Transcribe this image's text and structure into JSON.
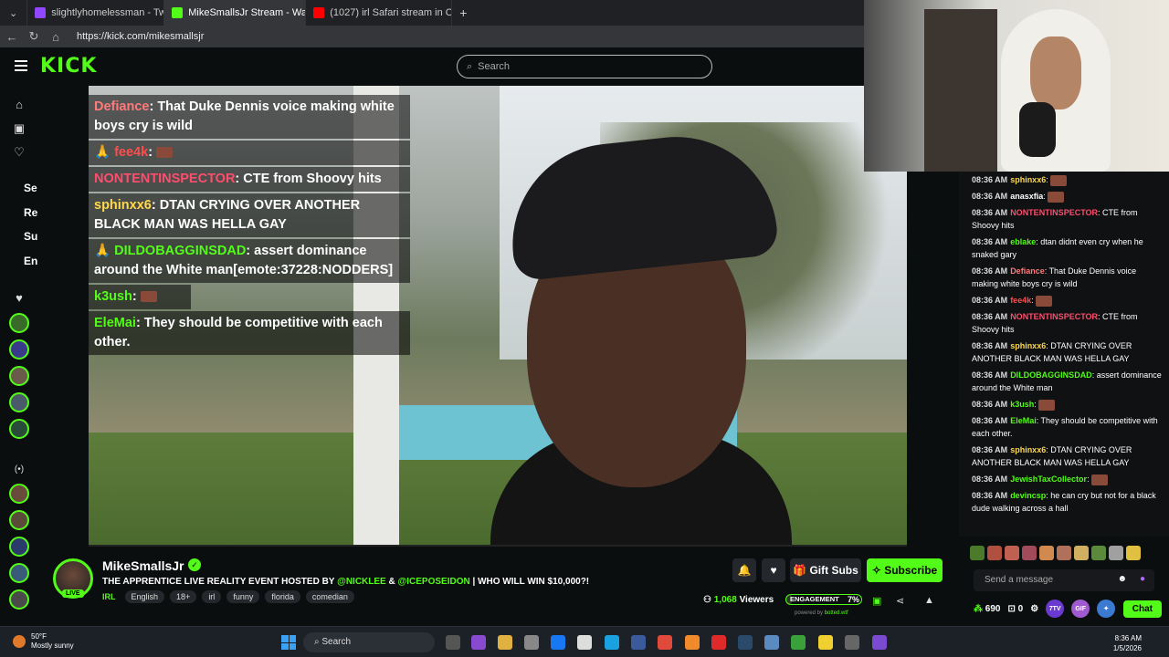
{
  "browser": {
    "tabs": [
      {
        "label": "slightlyhomelessman - Twitch",
        "color": "#9146ff",
        "active": false
      },
      {
        "label": "MikeSmallsJr Stream - Watch",
        "color": "#53fc18",
        "active": true
      },
      {
        "label": "(1027) irl Safari stream in Okl",
        "color": "#ff0000",
        "active": false
      }
    ],
    "new_tab": "+",
    "url": "https://kick.com/mikesmallsjr"
  },
  "header": {
    "logo": "KICK",
    "search_placeholder": "Search"
  },
  "leftnav": {
    "labels": [
      "Se",
      "Re",
      "Su",
      "En"
    ]
  },
  "overlay_chat": [
    {
      "user": "Defiance",
      "user_color": "#ff7a7a",
      "text": "That Duke Dennis voice making white boys cry is wild"
    },
    {
      "user": "fee4k",
      "user_color": "#ff4d4d",
      "text": ""
    },
    {
      "user": "NONTENTINSPECTOR",
      "user_color": "#ff4d6d",
      "text": "CTE from Shoovy hits"
    },
    {
      "user": "sphinxx6",
      "user_color": "#ffd84d",
      "text": "DTAN CRYING OVER ANOTHER BLACK MAN WAS HELLA GAY"
    },
    {
      "user": "DILDOBAGGINSDAD",
      "user_color": "#53fc18",
      "text": "assert dominance around the White man[emote:37228:NODDERS]"
    },
    {
      "user": "k3ush",
      "user_color": "#53fc18",
      "text": ""
    },
    {
      "user": "EleMai",
      "user_color": "#53fc18",
      "text": "They should be competitive with each other."
    }
  ],
  "chat": {
    "messages": [
      {
        "time": "08:36 AM",
        "user": "sphinxx6",
        "user_color": "#ffd84d",
        "text": ""
      },
      {
        "time": "08:36 AM",
        "user": "anasxfia",
        "user_color": "#ffffff",
        "text": ""
      },
      {
        "time": "08:36 AM",
        "user": "NONTENTINSPECTOR",
        "user_color": "#ff4d6d",
        "text": "CTE from Shoovy hits"
      },
      {
        "time": "08:36 AM",
        "user": "eblake",
        "user_color": "#53fc18",
        "text": "dtan didnt even cry when he snaked gary"
      },
      {
        "time": "08:36 AM",
        "user": "Defiance",
        "user_color": "#ff7a7a",
        "text": "That Duke Dennis voice making white boys cry is wild"
      },
      {
        "time": "08:36 AM",
        "user": "fee4k",
        "user_color": "#ff4d4d",
        "text": ""
      },
      {
        "time": "08:36 AM",
        "user": "NONTENTINSPECTOR",
        "user_color": "#ff4d6d",
        "text": "CTE from Shoovy hits"
      },
      {
        "time": "08:36 AM",
        "user": "sphinxx6",
        "user_color": "#ffd84d",
        "text": "DTAN CRYING OVER ANOTHER BLACK MAN WAS HELLA GAY"
      },
      {
        "time": "08:36 AM",
        "user": "DILDOBAGGINSDAD",
        "user_color": "#53fc18",
        "text": "assert dominance around the White man"
      },
      {
        "time": "08:36 AM",
        "user": "k3ush",
        "user_color": "#53fc18",
        "text": ""
      },
      {
        "time": "08:36 AM",
        "user": "EleMai",
        "user_color": "#53fc18",
        "text": "They should be competitive with each other."
      },
      {
        "time": "08:36 AM",
        "user": "sphinxx6",
        "user_color": "#ffd84d",
        "text": "DTAN CRYING OVER ANOTHER BLACK MAN WAS HELLA GAY"
      },
      {
        "time": "08:36 AM",
        "user": "JewishTaxCollector",
        "user_color": "#53fc18",
        "text": ""
      },
      {
        "time": "08:36 AM",
        "user": "devincsp",
        "user_color": "#53fc18",
        "text": "he can cry but not for a black dude walking across a hall"
      }
    ],
    "input_placeholder": "Send a message",
    "points": "690",
    "count": "0",
    "chat_button": "Chat"
  },
  "stream": {
    "name": "MikeSmallsJr",
    "live": "LIVE",
    "title_pre": "THE APPRENTICE LIVE REALITY EVENT HOSTED BY ",
    "mention1": "@NICKLEE",
    "title_mid": " & ",
    "mention2": "@ICEPOSEIDON",
    "title_post": " | WHO WILL WIN $10,000?!",
    "category": "IRL",
    "tags": [
      "English",
      "18+",
      "irl",
      "funny",
      "florida",
      "comedian"
    ],
    "gift_subs": "Gift Subs",
    "subscribe": "Subscribe",
    "viewers_count": "1,068",
    "viewers_label": "Viewers",
    "engagement_label": "ENGAGEMENT",
    "engagement_pct": "7%",
    "powered_by": "powered by",
    "powered_brand": "botted.wtf"
  },
  "taskbar": {
    "temp": "50°F",
    "weather": "Mostly sunny",
    "search": "Search",
    "time": "8:36 AM",
    "date": "1/5/2026"
  },
  "colors": {
    "accent": "#53fc18",
    "bg": "#0b0e0f"
  }
}
